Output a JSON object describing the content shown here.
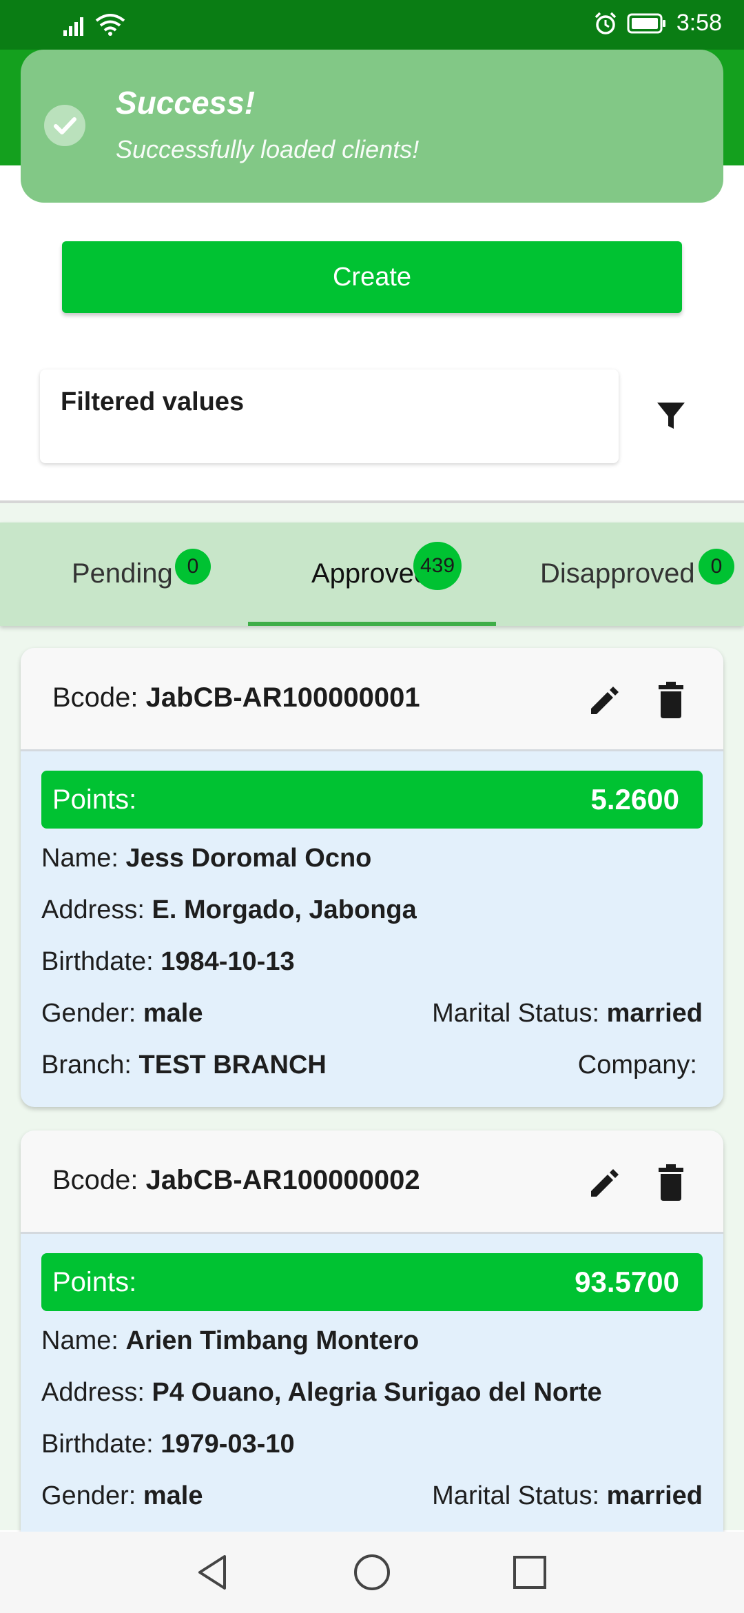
{
  "status_bar": {
    "time": "3:58"
  },
  "toast": {
    "title": "Success!",
    "message": "Successfully loaded clients!"
  },
  "create_label": "Create",
  "filter": {
    "label": "Filtered values"
  },
  "tabs": [
    {
      "label": "Pending",
      "count": "0"
    },
    {
      "label": "Approved",
      "count": "439"
    },
    {
      "label": "Disapproved",
      "count": "0"
    }
  ],
  "labels": {
    "bcode": "Bcode:",
    "points": "Points:",
    "name": "Name:",
    "address": "Address:",
    "birthdate": "Birthdate:",
    "gender": "Gender:",
    "marital": "Marital Status:",
    "branch": "Branch:",
    "company": "Company:"
  },
  "clients": [
    {
      "bcode": "JabCB-AR100000001",
      "points": "5.2600",
      "name": "Jess Doromal Ocno",
      "address": "E. Morgado, Jabonga",
      "birthdate": "1984-10-13",
      "gender": "male",
      "marital_status": "married",
      "branch": "TEST BRANCH",
      "company": ""
    },
    {
      "bcode": "JabCB-AR100000002",
      "points": "93.5700",
      "name": "Arien Timbang Montero",
      "address": "P4 Ouano, Alegria Surigao del Norte",
      "birthdate": "1979-03-10",
      "gender": "male",
      "marital_status": "married"
    }
  ],
  "colors": {
    "primary": "#00c232",
    "status_bar": "#0a7d14",
    "toast": "#82c886",
    "tabs": "#c8e6c9",
    "card_body": "#e3f0fb"
  }
}
